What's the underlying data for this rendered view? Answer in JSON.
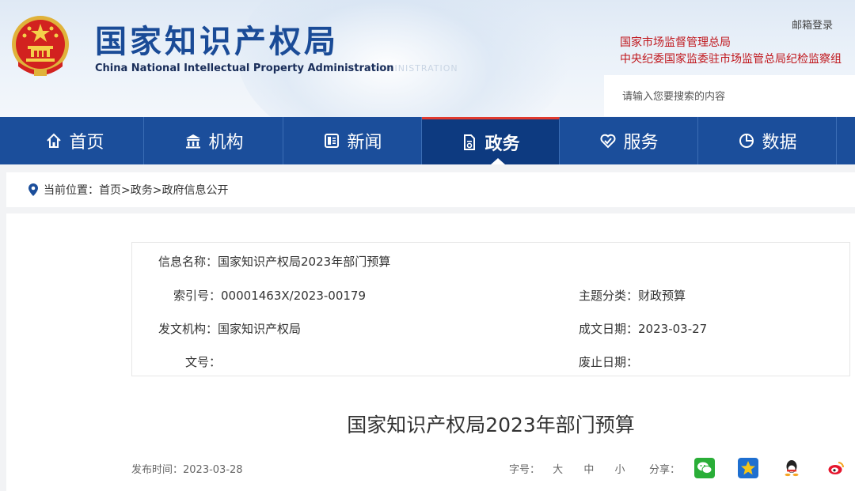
{
  "header": {
    "title_cn": "国家知识产权局",
    "title_en": "China National Intellectual Property Administration",
    "watermark": "ADMINISTRATION",
    "login_label": "邮箱登录",
    "external_links": [
      "国家市场监督管理总局",
      "中央纪委国家监委驻市场监管总局纪检监察组"
    ],
    "search_placeholder": "请输入您要搜索的内容",
    "colors": {
      "brand_blue": "#1a4b97",
      "link_red": "#c0161c"
    }
  },
  "nav": {
    "items": [
      {
        "label": "首页",
        "icon": "home-icon"
      },
      {
        "label": "机构",
        "icon": "institution-icon"
      },
      {
        "label": "新闻",
        "icon": "news-icon"
      },
      {
        "label": "政务",
        "icon": "government-affairs-icon",
        "active": true
      },
      {
        "label": "服务",
        "icon": "service-icon"
      },
      {
        "label": "数据",
        "icon": "data-pie-icon"
      }
    ]
  },
  "breadcrumb": {
    "prefix": "当前位置：",
    "path": "首页>政务>政府信息公开"
  },
  "info": {
    "name_label": "信息名称：",
    "name_value": "国家知识产权局2023年部门预算",
    "index_label": "索引号：",
    "index_value": "00001463X/2023-00179",
    "topic_label": "主题分类：",
    "topic_value": "财政预算",
    "issuer_label": "发文机构：",
    "issuer_value": "国家知识产权局",
    "date_label": "成文日期：",
    "date_value": "2023-03-27",
    "docno_label": "文号：",
    "docno_value": "",
    "expire_label": "废止日期：",
    "expire_value": ""
  },
  "document": {
    "title": "国家知识产权局2023年部门预算",
    "publish_label": "发布时间：",
    "publish_date": "2023-03-28",
    "font_size_label": "字号：",
    "font_sizes": [
      "大",
      "中",
      "小"
    ],
    "share_label": "分享："
  }
}
